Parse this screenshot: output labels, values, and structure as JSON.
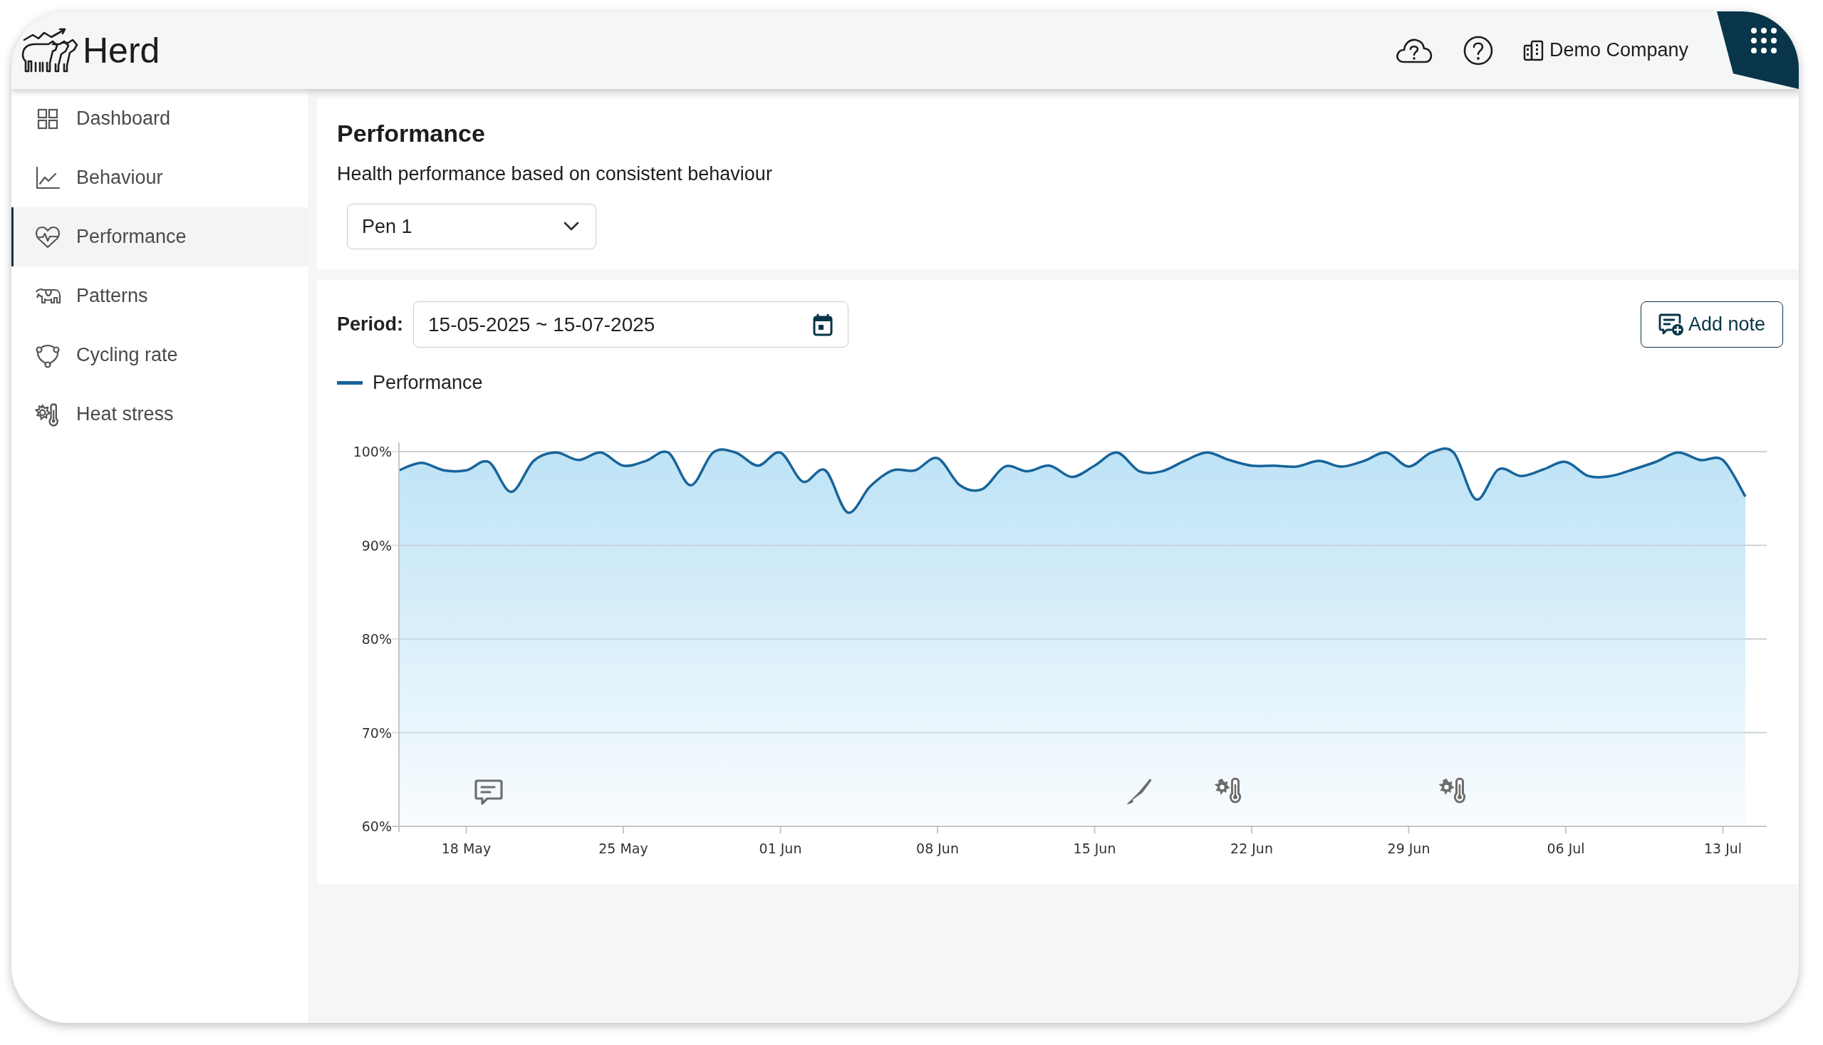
{
  "app": {
    "name": "Herd"
  },
  "header": {
    "company": "Demo Company"
  },
  "sidebar": {
    "items": [
      {
        "label": "Dashboard",
        "selected": false
      },
      {
        "label": "Behaviour",
        "selected": false
      },
      {
        "label": "Performance",
        "selected": true
      },
      {
        "label": "Patterns",
        "selected": false
      },
      {
        "label": "Cycling rate",
        "selected": false
      },
      {
        "label": "Heat stress",
        "selected": false
      }
    ]
  },
  "page": {
    "title": "Performance",
    "subtitle": "Health performance based on consistent behaviour",
    "pen_select": {
      "value": "Pen 1"
    }
  },
  "chart_panel": {
    "period_label": "Period:",
    "period_value": "15-05-2025 ~ 15-07-2025",
    "add_note_button": "Add note",
    "chart_data": {
      "type": "line",
      "ylim": [
        60,
        100
      ],
      "grid": true,
      "yticks": [
        {
          "value": 60,
          "label": "60%"
        },
        {
          "value": 70,
          "label": "70%"
        },
        {
          "value": 80,
          "label": "80%"
        },
        {
          "value": 90,
          "label": "90%"
        },
        {
          "value": 100,
          "label": "100%"
        }
      ],
      "categories": [
        null,
        null,
        null,
        "18 May",
        null,
        null,
        null,
        null,
        null,
        null,
        "25 May",
        null,
        null,
        null,
        null,
        null,
        null,
        "01 Jun",
        null,
        null,
        null,
        null,
        null,
        null,
        "08 Jun",
        null,
        null,
        null,
        null,
        null,
        null,
        "15 Jun",
        null,
        null,
        null,
        null,
        null,
        null,
        "22 Jun",
        null,
        null,
        null,
        null,
        null,
        null,
        "29 Jun",
        null,
        null,
        null,
        null,
        null,
        null,
        "06 Jul",
        null,
        null,
        null,
        null,
        null,
        null,
        "13 Jul",
        null
      ],
      "series": [
        {
          "name": "Performance",
          "color": "#17649a",
          "values": [
            98.0,
            98.8,
            98.0,
            98.0,
            98.9,
            95.7,
            99.0,
            99.9,
            99.1,
            99.9,
            98.5,
            99.0,
            99.9,
            96.4,
            99.9,
            99.9,
            98.5,
            99.9,
            96.8,
            98.0,
            93.5,
            96.3,
            98.0,
            98.0,
            99.3,
            96.4,
            96.0,
            98.4,
            97.9,
            98.5,
            97.3,
            98.5,
            99.9,
            97.9,
            97.9,
            99.0,
            99.9,
            99.1,
            98.5,
            98.5,
            98.4,
            99.0,
            98.4,
            99.0,
            99.9,
            98.4,
            99.9,
            99.9,
            94.9,
            98.1,
            97.4,
            98.1,
            98.9,
            97.4,
            97.4,
            98.1,
            98.9,
            99.9,
            99.1,
            99.1,
            95.2
          ]
        }
      ]
    }
  }
}
